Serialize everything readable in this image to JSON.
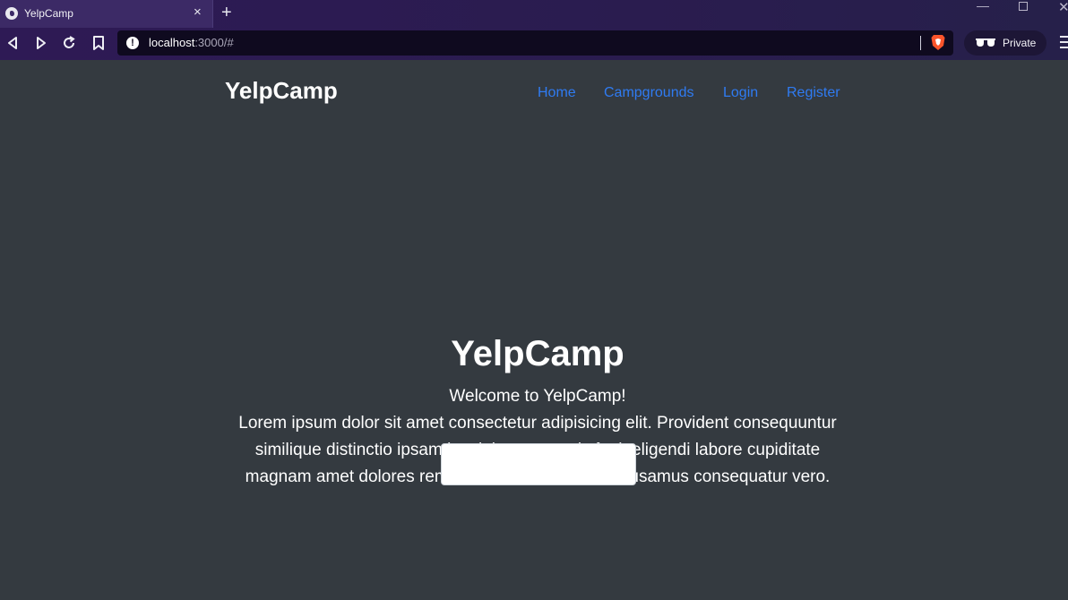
{
  "browser": {
    "tab_title": "YelpCamp",
    "close_tab_glyph": "×",
    "new_tab_glyph": "+",
    "url_host": "localhost",
    "url_rest": ":3000/#",
    "info_glyph": "!",
    "private_label": "Private",
    "win_min_glyph": "—",
    "win_close_glyph": "✕"
  },
  "navbar": {
    "brand": "YelpCamp",
    "links": {
      "home": "Home",
      "campgrounds": "Campgrounds",
      "login": "Login",
      "register": "Register"
    },
    "link_color": "#2f7bf2"
  },
  "hero": {
    "title": "YelpCamp",
    "welcome": "Welcome to YelpCamp!",
    "body": "Lorem ipsum dolor sit amet consectetur adipisicing elit. Provident consequuntur similique distinctio ipsam iste laborum omnis fugit eligendi labore cupiditate magnam amet dolores rem nemo animi autem, accusamus consequatur vero.",
    "button_label": ""
  },
  "colors": {
    "page_bg": "#343a40",
    "chrome_bg": "#2e1a55",
    "text": "#ffffff"
  }
}
